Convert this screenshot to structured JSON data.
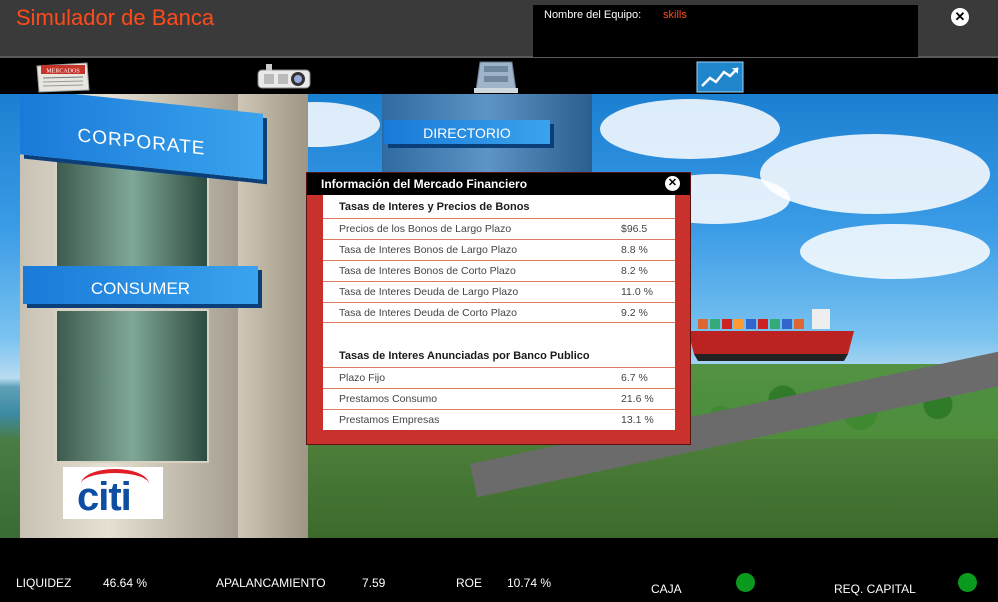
{
  "header": {
    "title": "Simulador de Banca",
    "team_label": "Nombre del Equipo:",
    "team_name": "skills"
  },
  "toolbar": {
    "items": [
      {
        "name": "newspaper-icon",
        "banner": "MERCADOS"
      },
      {
        "name": "projector-icon"
      },
      {
        "name": "building-icon"
      },
      {
        "name": "chart-icon"
      }
    ]
  },
  "scene": {
    "sign_corporate": "CORPORATE",
    "sign_directorio": "DIRECTORIO",
    "sign_consumer": "CONSUMER",
    "logo_citi": "citi"
  },
  "dialog": {
    "title": "Información del Mercado Financiero",
    "section1": {
      "title": "Tasas de Interes y Precios de Bonos",
      "rows": [
        {
          "label": "Precios de los Bonos de Largo Plazo",
          "value": "$96.5"
        },
        {
          "label": "Tasa de Interes Bonos de Largo Plazo",
          "value": "8.8 %"
        },
        {
          "label": "Tasa de Interes Bonos de Corto Plazo",
          "value": "8.2 %"
        },
        {
          "label": "Tasa de Interes Deuda de Largo Plazo",
          "value": "11.0 %"
        },
        {
          "label": "Tasa de Interes Deuda de Corto Plazo",
          "value": "9.2 %"
        }
      ]
    },
    "section2": {
      "title": "Tasas de Interes Anunciadas por Banco Publico",
      "rows": [
        {
          "label": "Plazo Fijo",
          "value": "6.7 %"
        },
        {
          "label": "Prestamos Consumo",
          "value": "21.6 %"
        },
        {
          "label": "Prestamos Empresas",
          "value": "13.1 %"
        }
      ]
    }
  },
  "status": {
    "liquidez_label": "LIQUIDEZ",
    "liquidez_value": "46.64 %",
    "apalancamiento_label": "APALANCAMIENTO",
    "apalancamiento_value": "7.59",
    "roe_label": "ROE",
    "roe_value": "10.74 %",
    "caja_label": "CAJA",
    "caja_status_color": "#0a9a1e",
    "req_capital_label": "REQ. CAPITAL",
    "req_capital_status_color": "#0a9a1e"
  }
}
